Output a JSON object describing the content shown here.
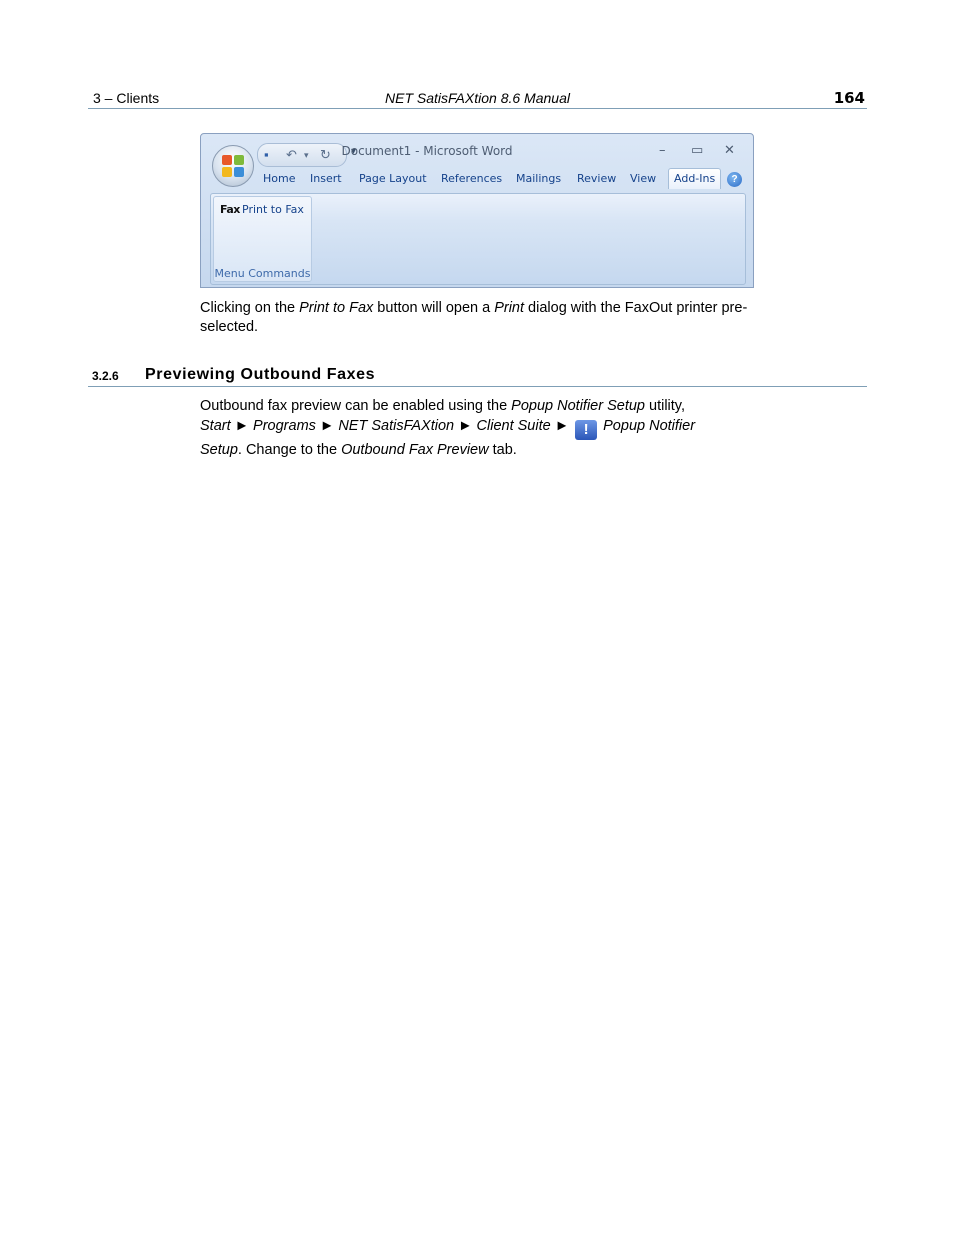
{
  "header": {
    "chapter": "3  – Clients",
    "manual_title": "NET SatisFAXtion 8.6 Manual",
    "page_number": "164"
  },
  "word_window": {
    "title": "Document1 - Microsoft Word",
    "tabs": [
      "Home",
      "Insert",
      "Page Layout",
      "References",
      "Mailings",
      "Review",
      "View",
      "Add-Ins"
    ],
    "active_tab": "Add-Ins",
    "fax_icon_text": "Fax",
    "print_to_fax_label": "Print to Fax",
    "group_label": "Menu Commands",
    "minimize_glyph": "–",
    "maximize_glyph": "▭",
    "close_glyph": "✕",
    "help_glyph": "?"
  },
  "paragraph1": {
    "t1": "Clicking on the ",
    "i1": "Print to Fax",
    "t2": " button will open a ",
    "i2": "Print",
    "t3": " dialog with the FaxOut printer pre-selected."
  },
  "section": {
    "number": "3.2.6",
    "title": "Previewing Outbound Faxes"
  },
  "paragraph2": {
    "t1": "Outbound fax preview can be enabled using the ",
    "i1": "Popup Notifier Setup",
    "t2": " utility,",
    "i2": "Start",
    "arrow": " ► ",
    "i3": "Programs",
    "i4": "NET SatisFAXtion",
    "i5": "Client Suite",
    "i6": "Popup Notifier Setup",
    "t3": ". Change to the ",
    "i7": "Outbound Fax Preview",
    "t4": " tab."
  }
}
